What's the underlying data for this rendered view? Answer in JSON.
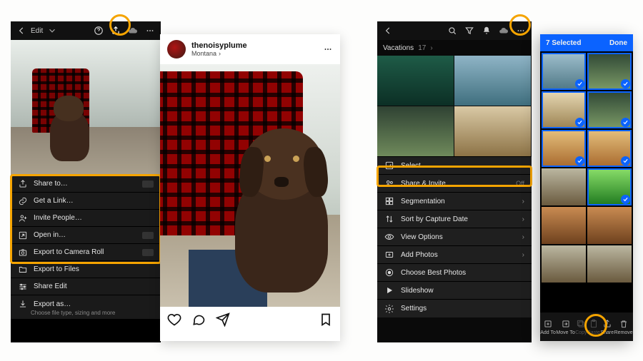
{
  "lr": {
    "edit_label": "Edit",
    "menu": {
      "share_to": "Share to…",
      "get_link": "Get a Link…",
      "invite": "Invite People…",
      "open_in": "Open in…",
      "export_roll": "Export to Camera Roll",
      "export_files": "Export to Files",
      "share_edit": "Share Edit",
      "export_as": "Export as…",
      "export_as_sub": "Choose file type, sizing and more"
    }
  },
  "ig": {
    "username": "thenoisyplume",
    "location": "Montana"
  },
  "grid": {
    "album": "Vacations",
    "count": "17",
    "menu": {
      "select": "Select",
      "share_invite": "Share & Invite",
      "share_invite_state": "Off",
      "segmentation": "Segmentation",
      "sort": "Sort by Capture Date",
      "view_opts": "View Options",
      "add_photos": "Add Photos",
      "best": "Choose Best Photos",
      "slideshow": "Slideshow",
      "settings": "Settings"
    }
  },
  "sel": {
    "count_label": "7 Selected",
    "done": "Done",
    "toolbar": {
      "add_to": "Add To",
      "move_to": "Move To",
      "copy": "Copy",
      "paste": "Paste",
      "share": "Share",
      "remove": "Remove"
    }
  }
}
